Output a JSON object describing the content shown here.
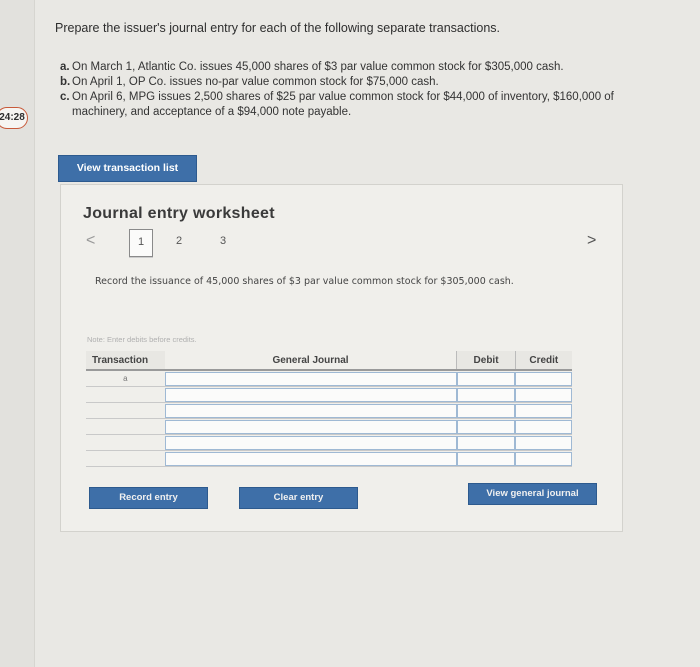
{
  "timer": "24:28",
  "question": "Prepare the issuer's journal entry for each of the following separate transactions.",
  "parts": [
    {
      "label": "a.",
      "text": "On March 1, Atlantic Co. issues 45,000 shares of $3 par value common stock for $305,000 cash."
    },
    {
      "label": "b.",
      "text": "On April 1, OP Co. issues no-par value common stock for $75,000 cash."
    },
    {
      "label": "c.",
      "text": "On April 6, MPG issues 2,500 shares of $25 par value common stock for $44,000 of inventory, $160,000 of machinery, and acceptance of a $94,000 note payable."
    }
  ],
  "view_transaction_list": "View transaction list",
  "worksheet": {
    "title": "Journal entry worksheet",
    "pages": [
      "1",
      "2",
      "3"
    ],
    "active_page": "1",
    "prev": "<",
    "next": ">",
    "instruction": "Record the issuance of 45,000 shares of $3 par value common stock for $305,000 cash.",
    "note": "Note: Enter debits before credits.",
    "columns": {
      "transaction": "Transaction",
      "journal": "General Journal",
      "debit": "Debit",
      "credit": "Credit"
    },
    "rows": [
      {
        "transaction": "a",
        "journal": "",
        "debit": "",
        "credit": ""
      },
      {
        "transaction": "",
        "journal": "",
        "debit": "",
        "credit": ""
      },
      {
        "transaction": "",
        "journal": "",
        "debit": "",
        "credit": ""
      },
      {
        "transaction": "",
        "journal": "",
        "debit": "",
        "credit": ""
      },
      {
        "transaction": "",
        "journal": "",
        "debit": "",
        "credit": ""
      },
      {
        "transaction": "",
        "journal": "",
        "debit": "",
        "credit": ""
      }
    ],
    "buttons": {
      "record": "Record entry",
      "clear": "Clear entry",
      "general": "View general journal"
    }
  },
  "colors": {
    "button_blue": "#3e6fa8",
    "timer_border": "#c85a3a"
  }
}
